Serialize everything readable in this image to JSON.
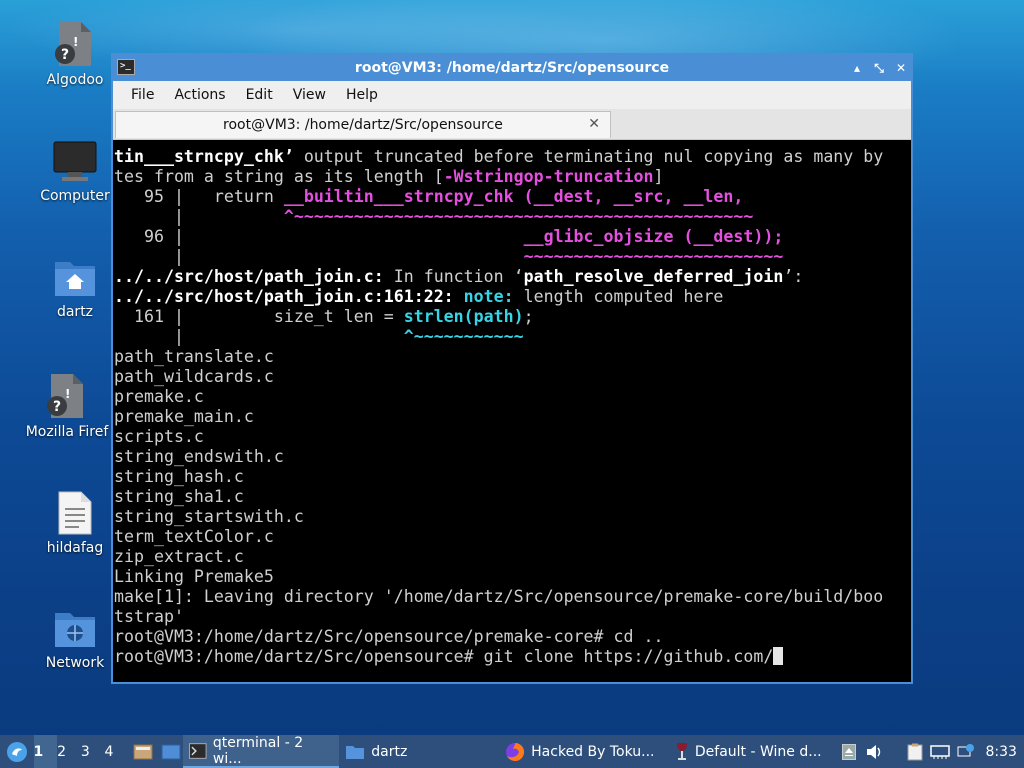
{
  "desktop": {
    "icons": [
      {
        "label": "Algodoo"
      },
      {
        "label": "Computer"
      },
      {
        "label": "dartz"
      },
      {
        "label": "Mozilla Firef"
      },
      {
        "label": "hildafag"
      },
      {
        "label": "Network"
      }
    ]
  },
  "window": {
    "title": "root@VM3: /home/dartz/Src/opensource",
    "controls": {
      "minimize": "▴",
      "maximize": "⤡",
      "close": "✕"
    },
    "menu": [
      "File",
      "Actions",
      "Edit",
      "View",
      "Help"
    ],
    "tab": {
      "label": "root@VM3: /home/dartz/Src/opensource",
      "close": "✕"
    }
  },
  "terminal": {
    "l1a": "tin___strncpy_chk’",
    "l1b": " output truncated before terminating nul copying as many by",
    "l2a": "tes from a string as its length [",
    "l2b": "-Wstringop-truncation",
    "l2c": "]",
    "l3a": "   95 |   return ",
    "l3b": "__builtin___strncpy_chk (__dest, __src, __len,",
    "l4a": "      |          ",
    "l4b": "^~~~~~~~~~~~~~~~~~~~~~~~~~~~~~~~~~~~~~~~~~~~~~~",
    "l5a": "   96 |                                  ",
    "l5b": "__glibc_objsize (__dest));",
    "l6a": "      |                                  ",
    "l6b": "~~~~~~~~~~~~~~~~~~~~~~~~~~",
    "l7a": "../../src/host/path_join.c:",
    "l7b": " In function ‘",
    "l7c": "path_resolve_deferred_join",
    "l7d": "’:",
    "l8a": "../../src/host/path_join.c:161:22:",
    "l8b": " note:",
    "l8c": " length computed here",
    "l9a": "  161 |         size_t len = ",
    "l9b": "strlen(path)",
    "l9c": ";",
    "l10a": "      |                      ",
    "l10b": "^~~~~~~~~~~~",
    "plain": [
      "path_translate.c",
      "path_wildcards.c",
      "premake.c",
      "premake_main.c",
      "scripts.c",
      "string_endswith.c",
      "string_hash.c",
      "string_sha1.c",
      "string_startswith.c",
      "term_textColor.c",
      "zip_extract.c",
      "Linking Premake5",
      "make[1]: Leaving directory '/home/dartz/Src/opensource/premake-core/build/boo",
      "tstrap'",
      "root@VM3:/home/dartz/Src/opensource/premake-core# cd ..",
      "root@VM3:/home/dartz/Src/opensource# git clone https://github.com/"
    ]
  },
  "taskbar": {
    "workspaces": [
      "1",
      "2",
      "3",
      "4"
    ],
    "tasks": [
      {
        "label": "qterminal - 2 wi..."
      },
      {
        "label": "dartz"
      },
      {
        "label": "Hacked By Toku..."
      },
      {
        "label": "Default - Wine d..."
      }
    ],
    "clock": "8:33"
  },
  "colors": {
    "titlebar": "#4a8fd6",
    "taskbar": "#2e4f7c",
    "magenta": "#e64fe0",
    "cyan": "#37d4e6"
  }
}
